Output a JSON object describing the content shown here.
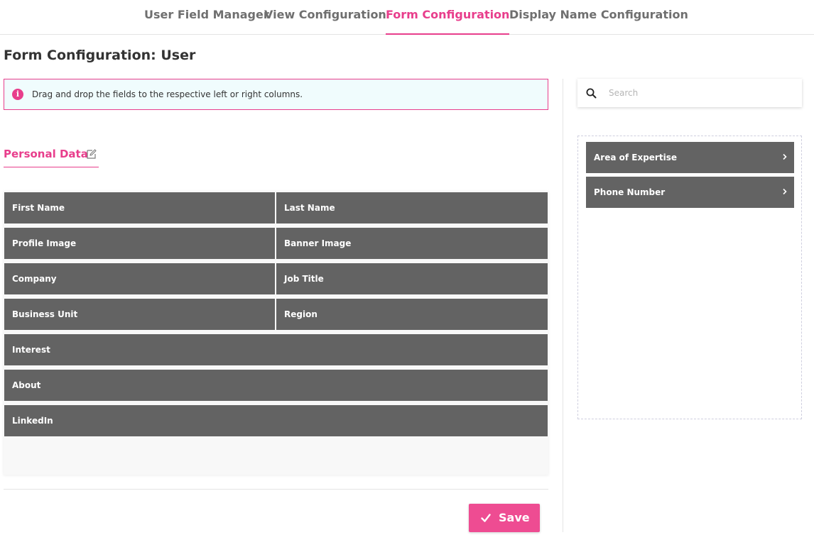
{
  "tabs": [
    {
      "label": "User Field Manager"
    },
    {
      "label": "View Configuration"
    },
    {
      "label": "Form Configuration",
      "active": true
    },
    {
      "label": "Display Name Configuration"
    }
  ],
  "page_title": "Form Configuration: User",
  "info": {
    "icon": "info-circle-icon",
    "text": "Drag and drop the fields to the respective left or right columns."
  },
  "section": {
    "label": "Personal Data",
    "edit_icon": "edit-icon"
  },
  "form_fields": {
    "first_name": "First Name",
    "last_name": "Last Name",
    "profile_image": "Profile Image",
    "banner_image": "Banner Image",
    "company": "Company",
    "job_title": "Job Title",
    "business_unit": "Business Unit",
    "region": "Region",
    "interest": "Interest",
    "about": "About",
    "linkedin": "LinkedIn"
  },
  "save": {
    "label": "Save",
    "icon": "check-icon"
  },
  "search": {
    "placeholder": "Search",
    "value": "",
    "icon": "search-icon"
  },
  "available_fields": [
    {
      "label": "Area of Expertise",
      "icon": "chevron-right-icon"
    },
    {
      "label": "Phone Number",
      "icon": "chevron-right-icon"
    }
  ],
  "colors": {
    "accent": "#e83e8c",
    "save_button": "#ee4c92",
    "field_bg": "#636363",
    "info_bg": "#f0fcfd"
  }
}
